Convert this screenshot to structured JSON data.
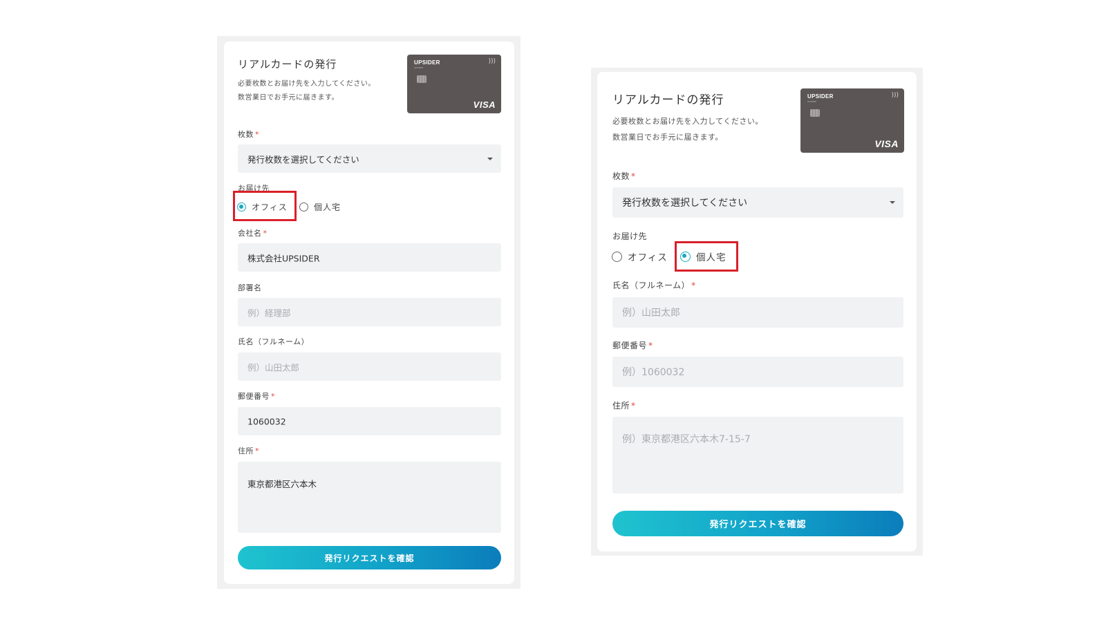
{
  "form": {
    "title": "リアルカードの発行",
    "desc_line1": "必要枚数とお届け先を入力してください。",
    "desc_line2": "数営業日でお手元に届きます。",
    "card": {
      "brand": "UPSIDER",
      "brand_sub": "UPSIDER",
      "network": "VISA"
    },
    "required_mark": "*",
    "count_label": "枚数",
    "count_placeholder": "発行枚数を選択してください",
    "delivery_label": "お届け先",
    "delivery_options": [
      "オフィス",
      "個人宅"
    ],
    "submit_label": "発行リクエストを確認"
  },
  "left": {
    "selected_delivery": "オフィス",
    "company_label": "会社名",
    "company_value": "株式会社UPSIDER",
    "department_label": "部署名",
    "department_placeholder": "例）経理部",
    "name_label": "氏名（フルネーム）",
    "name_placeholder": "例）山田太郎",
    "zip_label": "郵便番号",
    "zip_value": "1060032",
    "address_label": "住所",
    "address_value": "東京都港区六本木"
  },
  "right": {
    "selected_delivery": "個人宅",
    "name_label": "氏名（フルネーム）",
    "name_placeholder": "例）山田太郎",
    "zip_label": "郵便番号",
    "zip_placeholder": "例）1060032",
    "address_label": "住所",
    "address_placeholder": "例）東京都港区六本木7-15-7"
  },
  "colors": {
    "accent": "#1aa8bf",
    "highlight": "#d9202a",
    "required": "#e0463b",
    "field_bg": "#f1f2f4",
    "card_bg": "#5b5655"
  },
  "icons": [
    "caret-down-icon",
    "chip-icon",
    "contactless-icon"
  ]
}
